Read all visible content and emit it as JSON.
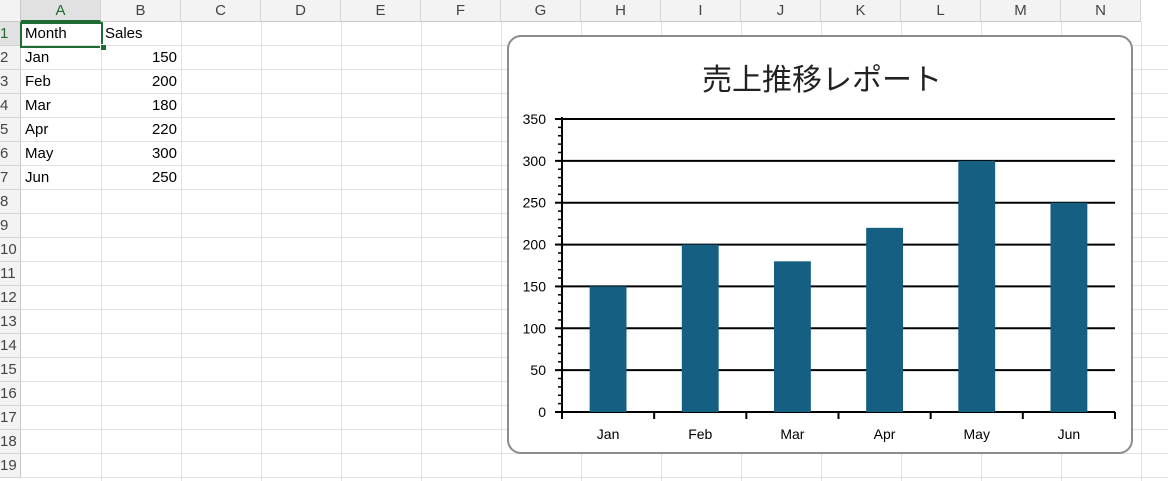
{
  "sheet": {
    "columns": [
      "A",
      "B",
      "C",
      "D",
      "E",
      "F",
      "G",
      "H",
      "I",
      "J",
      "K",
      "L",
      "M",
      "N"
    ],
    "rows": [
      "1",
      "2",
      "3",
      "4",
      "5",
      "6",
      "7",
      "8",
      "9",
      "10",
      "11",
      "12",
      "13",
      "14",
      "15",
      "16",
      "17",
      "18",
      "19"
    ],
    "selected_column": "A",
    "selected_row": "1",
    "cells": [
      {
        "col": "A",
        "row": 1,
        "value": "Month",
        "align": "left"
      },
      {
        "col": "B",
        "row": 1,
        "value": "Sales",
        "align": "left"
      },
      {
        "col": "A",
        "row": 2,
        "value": "Jan",
        "align": "left"
      },
      {
        "col": "B",
        "row": 2,
        "value": "150",
        "align": "right"
      },
      {
        "col": "A",
        "row": 3,
        "value": "Feb",
        "align": "left"
      },
      {
        "col": "B",
        "row": 3,
        "value": "200",
        "align": "right"
      },
      {
        "col": "A",
        "row": 4,
        "value": "Mar",
        "align": "left"
      },
      {
        "col": "B",
        "row": 4,
        "value": "180",
        "align": "right"
      },
      {
        "col": "A",
        "row": 5,
        "value": "Apr",
        "align": "left"
      },
      {
        "col": "B",
        "row": 5,
        "value": "220",
        "align": "right"
      },
      {
        "col": "A",
        "row": 6,
        "value": "May",
        "align": "left"
      },
      {
        "col": "B",
        "row": 6,
        "value": "300",
        "align": "right"
      },
      {
        "col": "A",
        "row": 7,
        "value": "Jun",
        "align": "left"
      },
      {
        "col": "B",
        "row": 7,
        "value": "250",
        "align": "right"
      }
    ]
  },
  "chart_data": {
    "type": "bar",
    "title": "売上推移レポート",
    "categories": [
      "Jan",
      "Feb",
      "Mar",
      "Apr",
      "May",
      "Jun"
    ],
    "series": [
      {
        "values": [
          150,
          200,
          180,
          220,
          300,
          250
        ],
        "color": "#156082"
      }
    ],
    "ylim": [
      0,
      350
    ],
    "yticks": [
      0,
      50,
      100,
      150,
      200,
      250,
      300,
      350
    ],
    "minor_tick_step": 10,
    "grid": true,
    "legend": "none",
    "xlabel": "",
    "ylabel": ""
  }
}
